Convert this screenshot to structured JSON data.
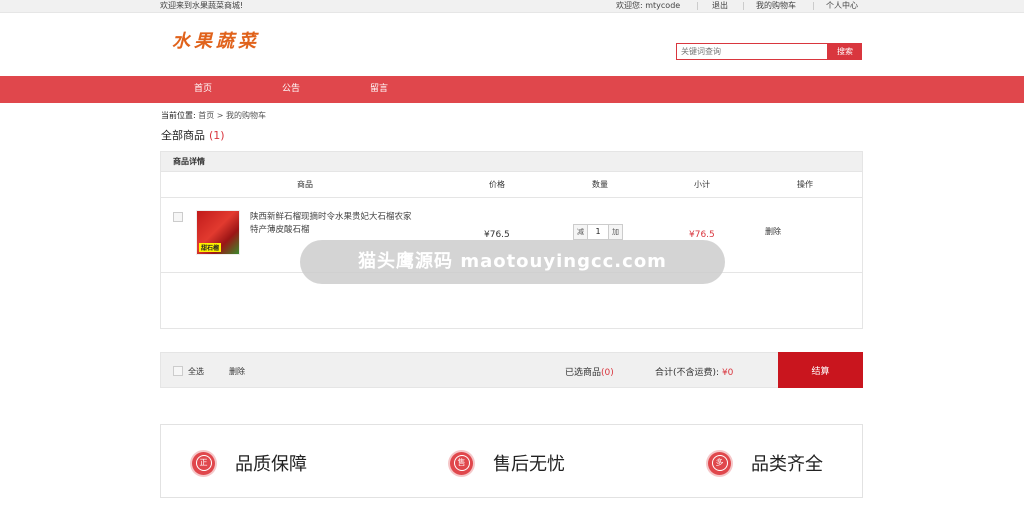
{
  "topbar": {
    "welcome": "欢迎来到水果蔬菜商城!",
    "user_greeting": "欢迎您: mtycode",
    "logout": "退出",
    "my_cart": "我的购物车",
    "user_center": "个人中心"
  },
  "header": {
    "logo_text": "水果蔬菜",
    "search_placeholder": "关键词查询",
    "search_button": "搜索"
  },
  "nav": {
    "items": [
      "首页",
      "公告",
      "留言"
    ]
  },
  "breadcrumb": {
    "label": "当前位置:",
    "path": "首页 > 我的购物车"
  },
  "all_goods": {
    "label": "全部商品",
    "count": "(1)"
  },
  "cart": {
    "title": "商品详情",
    "columns": [
      "商品",
      "价格",
      "数量",
      "小计",
      "操作"
    ],
    "items": [
      {
        "image_tag": "甜石榴",
        "name": "陕西新鲜石榴现摘时令水果贵妃大石榴农家特产薄皮酸石榴",
        "price": "¥76.5",
        "decrease": "减",
        "quantity": "1",
        "increase": "加",
        "subtotal": "¥76.5",
        "delete": "删除"
      }
    ]
  },
  "summary": {
    "select_all": "全选",
    "delete": "删除",
    "selected_label": "已选商品",
    "selected_count": "(0)",
    "total_label": "合计(不含运费):",
    "total_value": "¥0",
    "checkout": "结算"
  },
  "services": [
    {
      "icon": "正",
      "label": "品质保障"
    },
    {
      "icon": "售",
      "label": "售后无忧"
    },
    {
      "icon": "多",
      "label": "品类齐全"
    }
  ],
  "watermark": "猫头鹰源码 maotouyingcc.com",
  "colors": {
    "accent": "#e0474c",
    "checkout": "#c9151e",
    "price": "#d9363e",
    "logo": "#e0621b"
  }
}
